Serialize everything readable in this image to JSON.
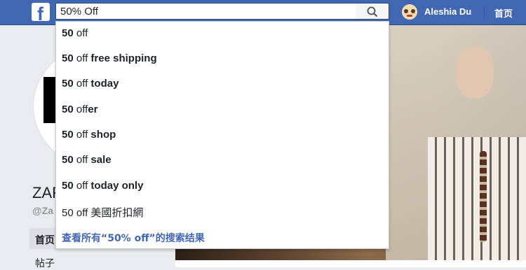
{
  "header": {
    "logo": "f",
    "search_value": "50% Off",
    "user_name": "Aleshia Du",
    "home_label": "首页"
  },
  "page": {
    "name": "ZAR",
    "handle": "@Za",
    "nav_home": "首页",
    "nav_posts": "帖子"
  },
  "suggestions": [
    {
      "bold_pre": "50",
      "normal": " off",
      "bold_post": ""
    },
    {
      "bold_pre": "50",
      "normal": " off",
      "bold_post": " free shipping"
    },
    {
      "bold_pre": "50",
      "normal": " off",
      "bold_post": " today"
    },
    {
      "bold_pre": "50",
      "normal": " off",
      "bold_post": "er"
    },
    {
      "bold_pre": "50",
      "normal": " off",
      "bold_post": " shop"
    },
    {
      "bold_pre": "50",
      "normal": " off",
      "bold_post": " sale"
    },
    {
      "bold_pre": "50",
      "normal": " off",
      "bold_post": " today only"
    },
    {
      "bold_pre": "",
      "normal": "50 off 美國折扣網",
      "bold_post": ""
    }
  ],
  "see_all": "查看所有“50% off”的搜索结果",
  "colors": {
    "topbar": "#4267b2",
    "link": "#4267b2"
  }
}
